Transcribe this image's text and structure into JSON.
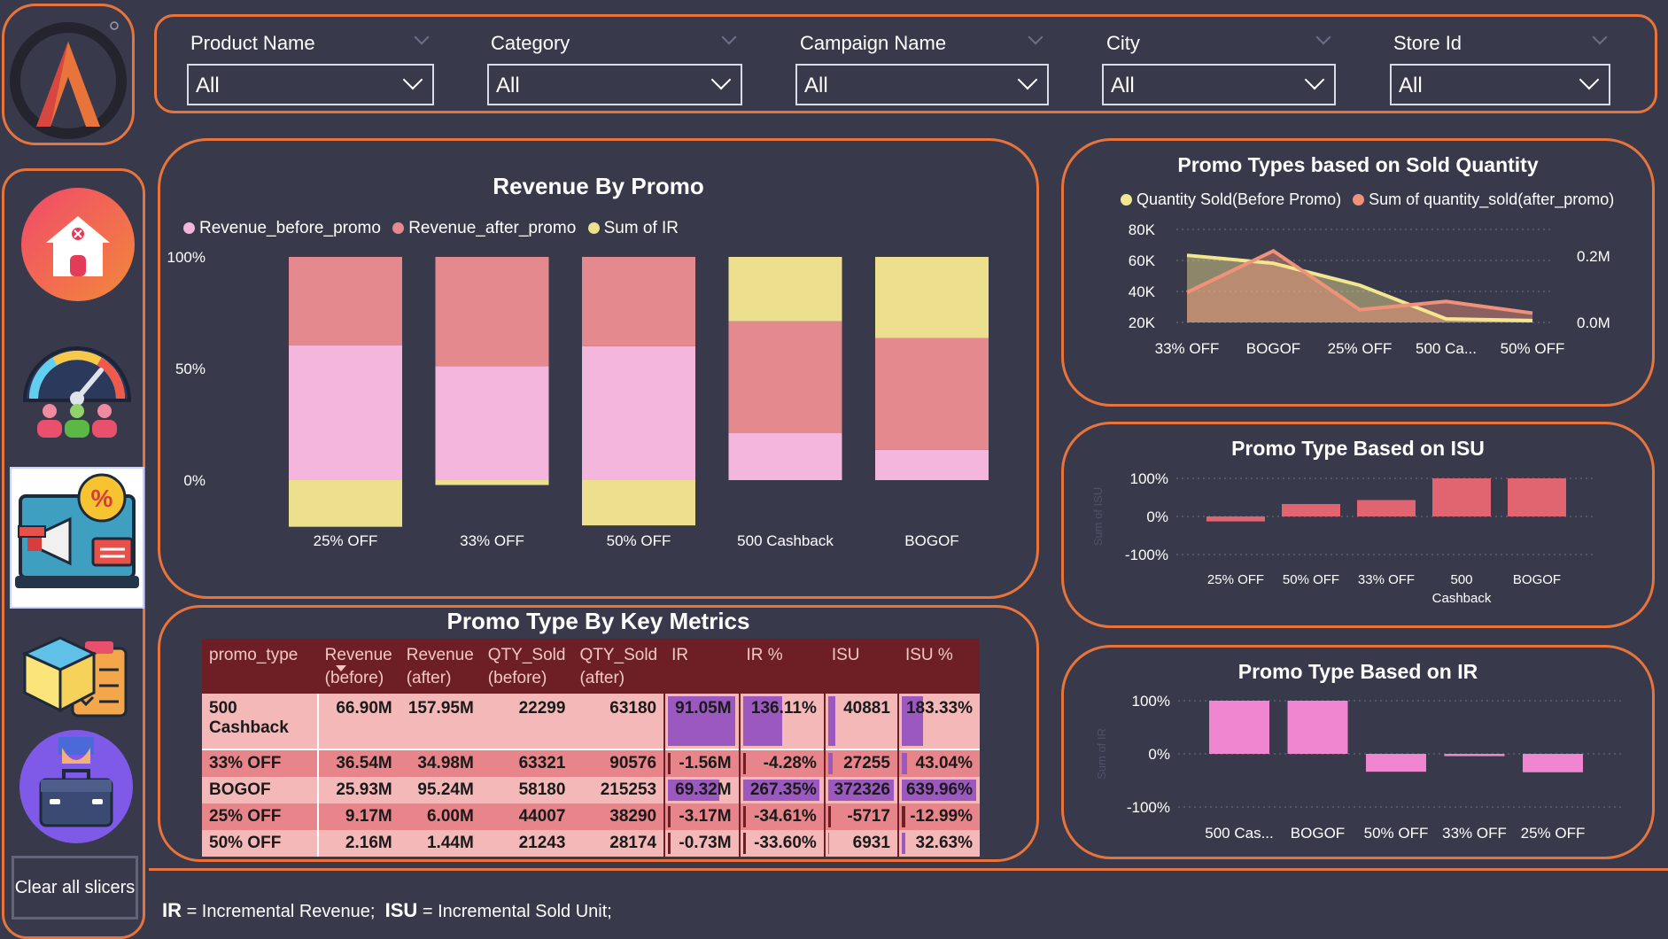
{
  "slicers": [
    {
      "label": "Product Name",
      "value": "All"
    },
    {
      "label": "Category",
      "value": "All"
    },
    {
      "label": "Campaign Name",
      "value": "All"
    },
    {
      "label": "City",
      "value": "All"
    },
    {
      "label": "Store Id",
      "value": "All"
    }
  ],
  "nav": {
    "clear_label": "Clear all slicers"
  },
  "colors": {
    "accent": "#e8743b",
    "background": "#383a4c",
    "before_promo": "#f4b6dd",
    "after_promo": "#e48a8f",
    "ir": "#ece08f",
    "isu_bar": "#e06570",
    "ir_bar": "#ef86cf",
    "qty_before": "#f3e690",
    "qty_after": "#f0927a",
    "table_header": "#6e1f25",
    "data_bar": "#9b59c0"
  },
  "chart_data": [
    {
      "type": "bar",
      "stacked": "100%",
      "title": "Revenue By Promo",
      "categories": [
        "25% OFF",
        "33% OFF",
        "50% OFF",
        "500 Cashback",
        "BOGOF"
      ],
      "series": [
        {
          "name": "Revenue_before_promo",
          "values": [
            9.17,
            36.54,
            2.16,
            66.9,
            25.93
          ]
        },
        {
          "name": "Revenue_after_promo",
          "values": [
            6.0,
            34.98,
            1.44,
            157.95,
            95.24
          ]
        },
        {
          "name": "Sum of IR",
          "values": [
            -3.17,
            -1.56,
            -0.73,
            91.05,
            69.32
          ]
        }
      ],
      "yticks": [
        "100%",
        "50%",
        "0%"
      ],
      "legend": "top-left"
    },
    {
      "type": "area",
      "title": "Promo Types based on Sold Quantity",
      "categories": [
        "33% OFF",
        "BOGOF",
        "25% OFF",
        "500 Ca...",
        "50% OFF"
      ],
      "series": [
        {
          "name": "Quantity Sold(Before Promo)",
          "values": [
            63321,
            58180,
            44007,
            22299,
            21243
          ]
        },
        {
          "name": "Sum of quantity_sold(after_promo)",
          "values": [
            90576,
            215253,
            38290,
            63180,
            28174
          ]
        }
      ],
      "yticks_left": [
        "80K",
        "60K",
        "40K",
        "20K"
      ],
      "yticks_right": [
        "0.2M",
        "0.0M"
      ],
      "legend": "top"
    },
    {
      "type": "bar",
      "title": "Promo Type Based on ISU",
      "ylabel": "Sum of ISU",
      "categories": [
        "25% OFF",
        "50% OFF",
        "33% OFF",
        "500 Cashback",
        "BOGOF"
      ],
      "values": [
        -12.99,
        32.63,
        43.04,
        183.33,
        639.96
      ],
      "yticks": [
        "100%",
        "0%",
        "-100%"
      ],
      "ylim": [
        -100,
        100
      ]
    },
    {
      "type": "bar",
      "title": "Promo Type Based on IR",
      "ylabel": "Sum of IR",
      "categories": [
        "500 Cas...",
        "BOGOF",
        "50% OFF",
        "33% OFF",
        "25% OFF"
      ],
      "values": [
        136.11,
        267.35,
        -33.6,
        -4.28,
        -34.61
      ],
      "yticks": [
        "100%",
        "0%",
        "-100%"
      ],
      "ylim": [
        -100,
        100
      ]
    },
    {
      "type": "table",
      "title": "Promo Type By Key Metrics",
      "headers": [
        "promo_type",
        "Revenue (before)",
        "Revenue (after)",
        "QTY_Sold (before)",
        "QTY_Sold (after)",
        "IR",
        "IR %",
        "ISU",
        "ISU %"
      ],
      "rows": [
        [
          "500 Cashback",
          "66.90M",
          "157.95M",
          "22299",
          "63180",
          "91.05M",
          "136.11%",
          "40881",
          "183.33%"
        ],
        [
          "33% OFF",
          "36.54M",
          "34.98M",
          "63321",
          "90576",
          "-1.56M",
          "-4.28%",
          "27255",
          "43.04%"
        ],
        [
          "BOGOF",
          "25.93M",
          "95.24M",
          "58180",
          "215253",
          "69.32M",
          "267.35%",
          "372326",
          "639.96%"
        ],
        [
          "25% OFF",
          "9.17M",
          "6.00M",
          "44007",
          "38290",
          "-3.17M",
          "-34.61%",
          "-5717",
          "-12.99%"
        ],
        [
          "50% OFF",
          "2.16M",
          "1.44M",
          "21243",
          "28174",
          "-0.73M",
          "-33.60%",
          "6931",
          "32.63%"
        ]
      ]
    }
  ],
  "footer": {
    "ir_abbr": "IR",
    "ir_text": "= Incremental Revenue;",
    "isu_abbr": "ISU",
    "isu_text": "= Incremental Sold Unit;"
  }
}
